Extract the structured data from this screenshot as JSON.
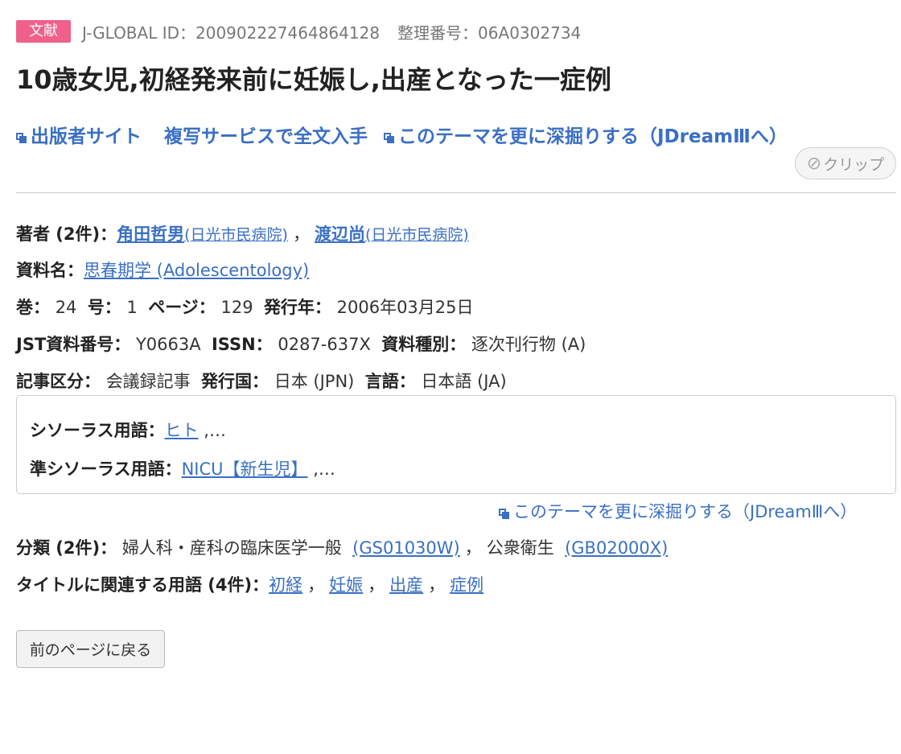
{
  "header": {
    "badge": "文献",
    "id_text": "J-GLOBAL ID：200902227464864128",
    "ref_text": "整理番号：06A0302734"
  },
  "title": "10歳女児,初経発来前に妊娠し,出産となった一症例",
  "links": {
    "publisher": "出版者サイト",
    "copy_service": "複写サービスで全文入手",
    "deep_dive": "このテーマを更に深掘りする（JDreamⅢへ）"
  },
  "clip": {
    "label": "クリップ",
    "icon": "paperclip-icon"
  },
  "authors": {
    "label": "著者 (2件)：",
    "items": [
      {
        "name": "角田哲男",
        "affil": "(日光市民病院)"
      },
      {
        "name": "渡辺尚",
        "affil": "(日光市民病院)"
      }
    ],
    "sep": "，"
  },
  "source": {
    "label": "資料名：",
    "value": "思春期学  (Adolescentology)"
  },
  "volume": {
    "vol_label": "巻：",
    "vol": "24",
    "no_label": "号：",
    "no": "1",
    "page_label": "ページ：",
    "page": "129",
    "year_label": "発行年：",
    "year": "2006年03月25日"
  },
  "jst": {
    "jst_label": "JST資料番号：",
    "jst": "Y0663A",
    "issn_label": "ISSN：",
    "issn": "0287-637X",
    "type_label": "資料種別：",
    "type": "逐次刊行物 (A)"
  },
  "article": {
    "kind_label": "記事区分：",
    "kind": "会議録記事",
    "country_label": "発行国：",
    "country": "日本 (JPN)",
    "lang_label": "言語：",
    "lang": "日本語 (JA)"
  },
  "thesaurus": {
    "label": "シソーラス用語：",
    "term": "ヒト",
    "more": " ,…",
    "sub_label": "準シソーラス用語：",
    "sub_term": "NICU【新生児】",
    "sub_more": " ,…"
  },
  "deep_dive2": "このテーマを更に深掘りする（JDreamⅢへ）",
  "classification": {
    "label": "分類 (2件)：",
    "items": [
      {
        "name": "婦人科・産科の臨床医学一般",
        "code": "(GS01030W)"
      },
      {
        "name": "公衆衛生",
        "code": "(GB02000X)"
      }
    ],
    "sep": "，"
  },
  "terms": {
    "label": "タイトルに関連する用語 (4件)：",
    "items": [
      "初経",
      "妊娠",
      "出産",
      "症例"
    ],
    "sep": "，"
  },
  "back_button": "前のページに戻る",
  "colors": {
    "badge": "#f0608a",
    "link": "#3a6fc4"
  }
}
